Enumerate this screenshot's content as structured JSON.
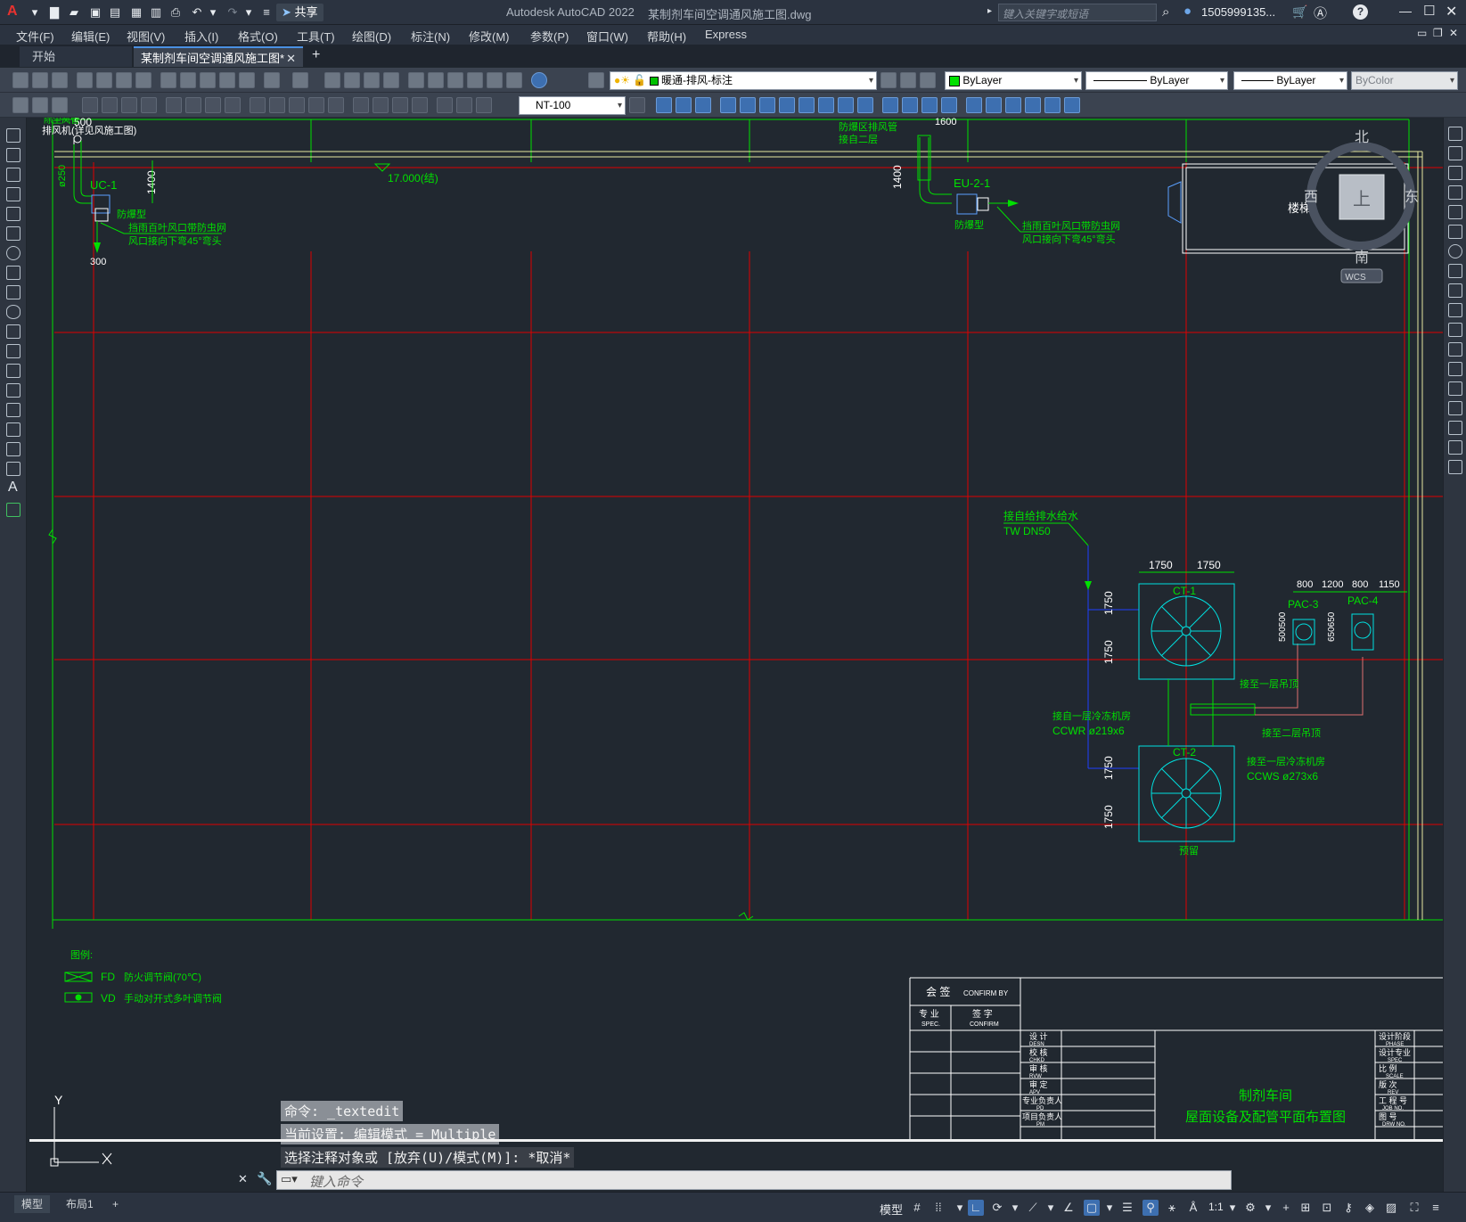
{
  "app": {
    "title": "Autodesk AutoCAD 2022",
    "document_name": "某制剂车间空调通风施工图.dwg",
    "search_placeholder": "键入关键字或短语",
    "user": "1505999135...",
    "share": "共享"
  },
  "menu": [
    "文件(F)",
    "编辑(E)",
    "视图(V)",
    "插入(I)",
    "格式(O)",
    "工具(T)",
    "绘图(D)",
    "标注(N)",
    "修改(M)",
    "参数(P)",
    "窗口(W)",
    "帮助(H)",
    "Express"
  ],
  "tabs": {
    "start": "开始",
    "active": "某制剂车间空调通风施工图*",
    "add": "+"
  },
  "toolbar": {
    "layer": "暖通-排风-标注",
    "color": "ByLayer",
    "linetype": "ByLayer",
    "lineweight": "ByLayer",
    "plotstyle": "ByColor",
    "dimstyle": "NT-100"
  },
  "compass": {
    "north": "北",
    "south": "南",
    "east": "东",
    "west": "西",
    "top": "上",
    "wcs": "WCS"
  },
  "drawing": {
    "stair": "楼梯",
    "elevation": "17.000(结)",
    "dim_500": "500",
    "dim_300": "300",
    "dim_1400a": "1400",
    "dim_1400b": "1400",
    "dim_1600": "1600",
    "dim_250": "ø250",
    "stub_label": "排风机(详见风施工图)",
    "dust_label": "除尘风管",
    "uc1": "UC-1",
    "eu21": "EU-2-1",
    "explosion_proof": "防爆型",
    "explosion_proof2": "防爆型",
    "louver_note1": "挡雨百叶风口带防虫网",
    "louver_note2": "风口接向下弯45°弯头",
    "louver_note3": "挡雨百叶风口带防虫网",
    "louver_note4": "风口接向下弯45°弯头",
    "exhaust_note1": "防爆区排风管",
    "exhaust_note2": "接自二层",
    "water_note": "接自给排水给水",
    "water_size": "TW DN50",
    "dim_1750a": "1750",
    "dim_1750b": "1750",
    "dim_v1750a": "1750",
    "dim_v1750b": "1750",
    "dim_v1750c": "1750",
    "dim_v1750d": "1750",
    "dim_800a": "800",
    "dim_1200": "1200",
    "dim_800b": "800",
    "dim_1150": "1150",
    "dim_500500": "500500",
    "dim_650650": "650650",
    "ct1": "CT-1",
    "ct2": "CT-2",
    "pac3": "PAC-3",
    "pac4": "PAC-4",
    "reserve": "预留",
    "to_ceiling1": "接至一层吊顶",
    "to_ceiling2": "接至二层吊顶",
    "from_chiller": "接自一层冷冻机房",
    "ccwr": "CCWR ø219x6",
    "to_chiller": "接至一层冷冻机房",
    "ccws": "CCWS ø273x6"
  },
  "legend": {
    "title": "图例:",
    "fd_code": "FD",
    "fd_text": "防火调节阀(70℃)",
    "vd_code": "VD",
    "vd_text": "手动对开式多叶调节阀"
  },
  "titleblock": {
    "confirm": "会 签",
    "confirm_en": "CONFIRM BY",
    "spec": "专 业",
    "spec_en": "SPEC.",
    "sign": "签 字",
    "sign_en": "CONFIRM",
    "rows": [
      {
        "cn": "设 计",
        "en": "DESN"
      },
      {
        "cn": "校 核",
        "en": "CHKD"
      },
      {
        "cn": "审 核",
        "en": "RVW"
      },
      {
        "cn": "审 定",
        "en": "APV"
      },
      {
        "cn": "专业负责人",
        "en": "PD"
      },
      {
        "cn": "项目负责人",
        "en": "PM"
      }
    ],
    "right_rows": [
      {
        "cn": "设计阶段",
        "en": "PHASE"
      },
      {
        "cn": "设计专业",
        "en": "SPEC"
      },
      {
        "cn": "比 例",
        "en": "SCALE"
      },
      {
        "cn": "版 次",
        "en": "REV"
      },
      {
        "cn": "工 程 号",
        "en": "JOB NO."
      },
      {
        "cn": "图 号",
        "en": "DRW NO."
      }
    ],
    "title1": "制剂车间",
    "title2": "屋面设备及配管平面布置图"
  },
  "command": {
    "line1": "命令: _textedit",
    "line2": "当前设置: 编辑模式 = Multiple",
    "line3": "选择注释对象或 [放弃(U)/模式(M)]: *取消*",
    "placeholder": "键入命令"
  },
  "layout_tabs": {
    "model": "模型",
    "layout1": "布局1",
    "add": "+"
  },
  "status": {
    "model": "模型",
    "scale": "1:1"
  },
  "ucs": {
    "y": "Y"
  },
  "colors": {
    "green": "#00ff00",
    "red": "#ff0000",
    "cyan": "#00ffff",
    "yellow": "#ffff00",
    "blue": "#0000ff",
    "white": "#ffffff",
    "bg": "#212830"
  }
}
